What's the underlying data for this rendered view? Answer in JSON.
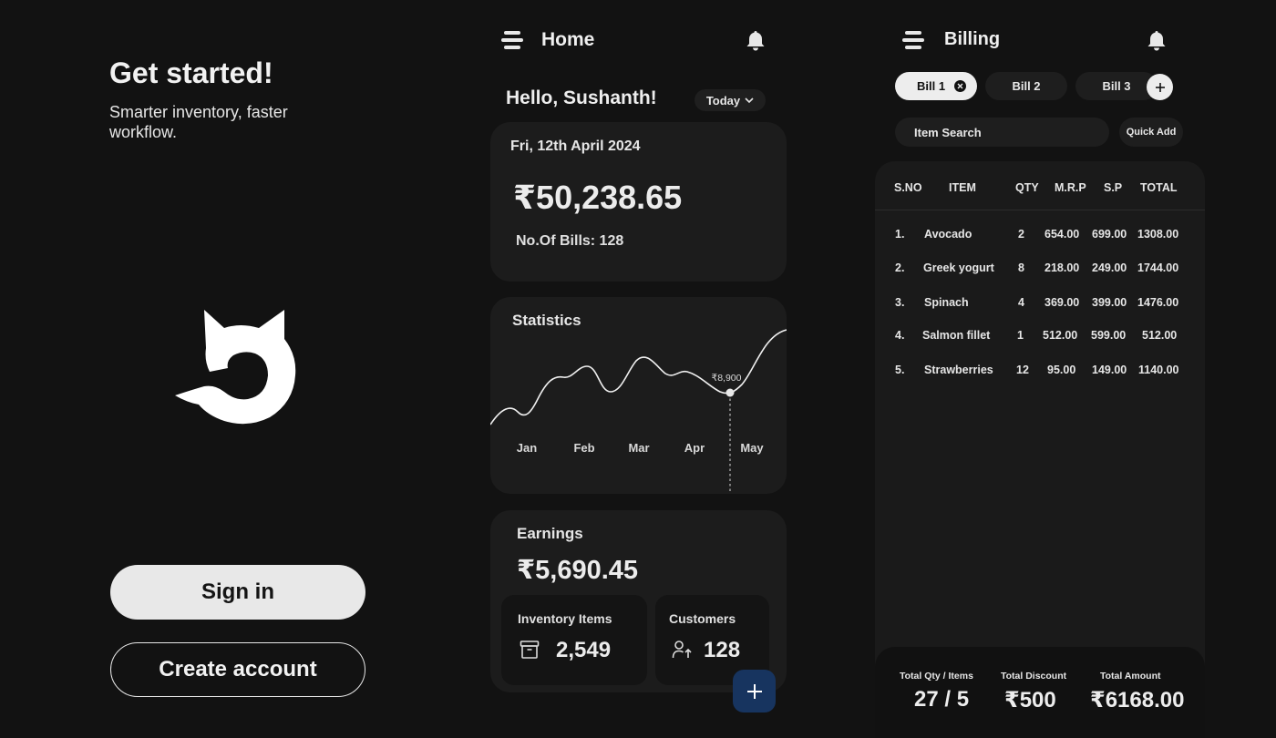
{
  "onboarding": {
    "title": "Get started!",
    "subtitle": "Smarter inventory, faster workflow.",
    "signin_label": "Sign in",
    "create_label": "Create account"
  },
  "home": {
    "title": "Home",
    "greeting": "Hello, Sushanth!",
    "period": "Today",
    "date": "Fri, 12th April 2024",
    "sales_amount": "₹50,238.65",
    "bills_count": "No.Of Bills: 128",
    "statistics": {
      "title": "Statistics",
      "months": [
        "Jan",
        "Feb",
        "Mar",
        "Apr",
        "May"
      ],
      "highlight_label": "₹8,900"
    },
    "earnings": {
      "title": "Earnings",
      "amount": "₹5,690.45",
      "inventory_label": "Inventory Items",
      "inventory_value": "2,549",
      "customers_label": "Customers",
      "customers_value": "128"
    }
  },
  "billing": {
    "title": "Billing",
    "tabs": [
      "Bill 1",
      "Bill 2",
      "Bill 3"
    ],
    "search_placeholder": "Item Search",
    "quick_add": "Quick Add",
    "headers": [
      "S.NO",
      "ITEM",
      "QTY",
      "M.R.P",
      "S.P",
      "TOTAL"
    ],
    "rows": [
      {
        "sno": "1.",
        "item": "Avocado",
        "qty": "2",
        "mrp": "654.00",
        "sp": "699.00",
        "total": "1308.00"
      },
      {
        "sno": "2.",
        "item": "Greek yogurt",
        "qty": "8",
        "mrp": "218.00",
        "sp": "249.00",
        "total": "1744.00"
      },
      {
        "sno": "3.",
        "item": "Spinach",
        "qty": "4",
        "mrp": "369.00",
        "sp": "399.00",
        "total": "1476.00"
      },
      {
        "sno": "4.",
        "item": "Salmon fillet",
        "qty": "1",
        "mrp": "512.00",
        "sp": "599.00",
        "total": "512.00"
      },
      {
        "sno": "5.",
        "item": "Strawberries",
        "qty": "12",
        "mrp": "95.00",
        "sp": "149.00",
        "total": "1140.00"
      }
    ],
    "totals": {
      "qty_label": "Total Qty / Items",
      "qty_value": "27 / 5",
      "discount_label": "Total Discount",
      "discount_value": "₹500",
      "amount_label": "Total Amount",
      "amount_value": "₹6168.00"
    }
  },
  "colors": {
    "background": "#121212",
    "card": "#1c1c1c",
    "accent_fab": "#17345f",
    "primary_button": "#e8e8e8"
  }
}
